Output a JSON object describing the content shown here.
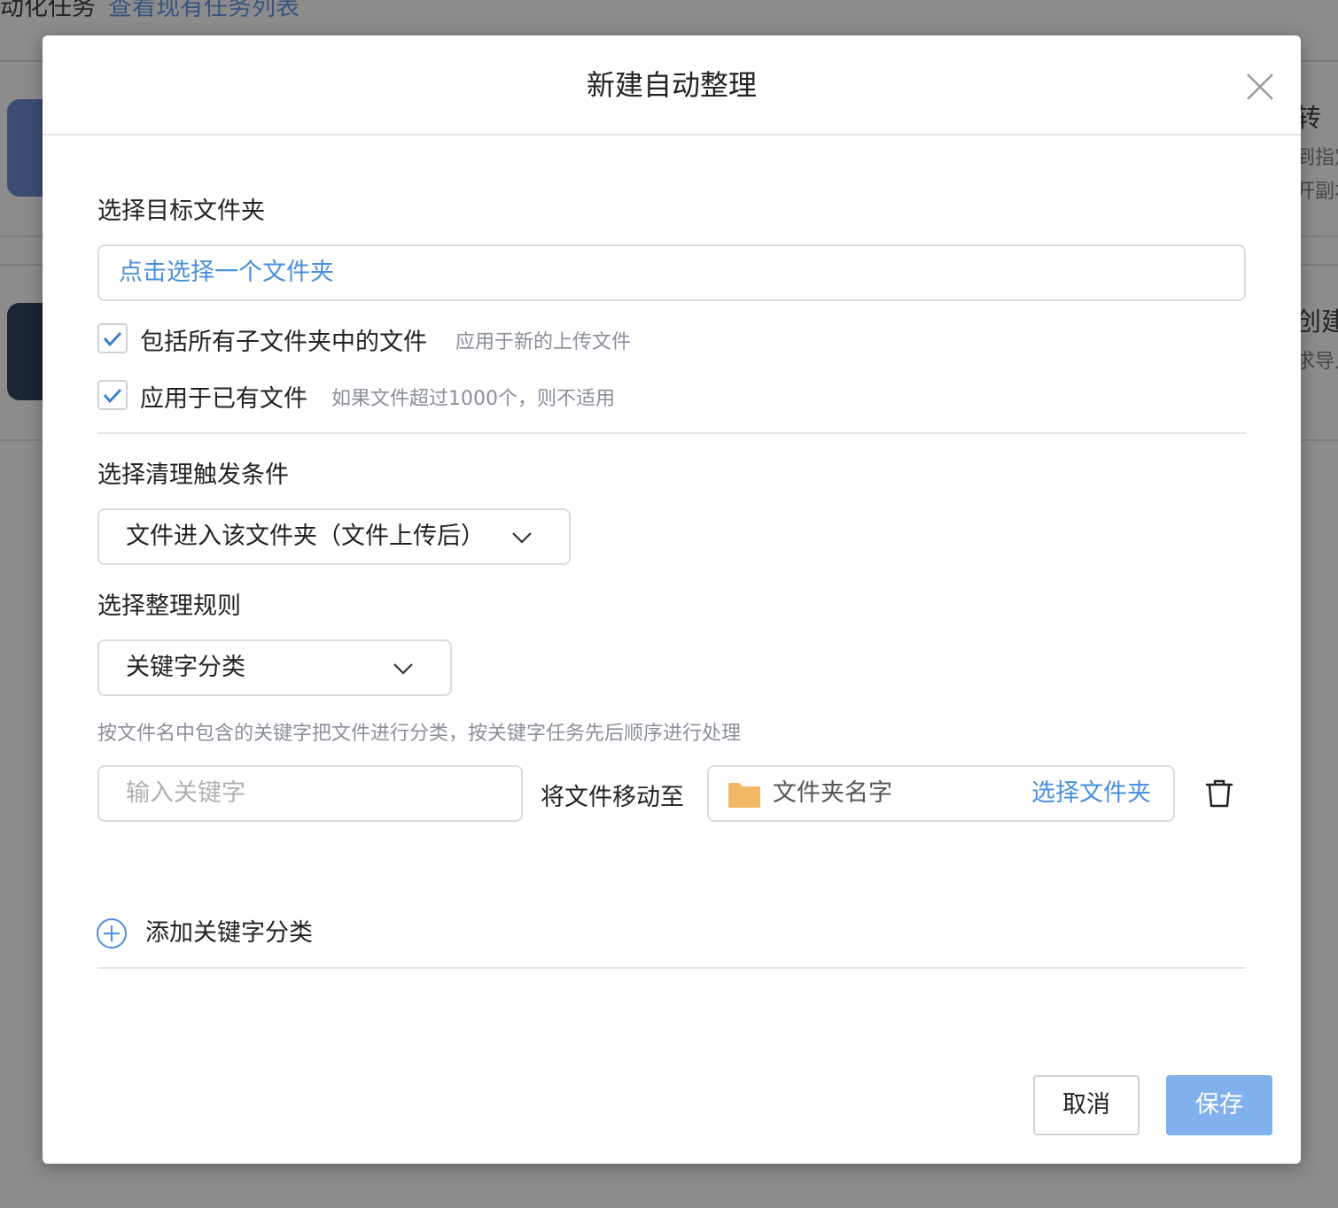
{
  "background": {
    "top_text": "动化任务",
    "top_link": "查看现有任务列表",
    "right_items": [
      {
        "title": "转",
        "sub1": "到指定",
        "sub2": "开副本"
      },
      {
        "title": "创建",
        "sub1": "求导入"
      }
    ]
  },
  "modal": {
    "title": "新建自动整理",
    "close_icon": "close-icon",
    "target_section": {
      "label": "选择目标文件夹",
      "picker_text": "点击选择一个文件夹"
    },
    "options": [
      {
        "label": "包括所有子文件夹中的文件",
        "hint": "应用于新的上传文件",
        "checked": true
      },
      {
        "label": "应用于已有文件",
        "hint": "如果文件超过1000个，则不适用",
        "checked": true
      }
    ],
    "trigger_section": {
      "label": "选择清理触发条件",
      "selected": "文件进入该文件夹（文件上传后）"
    },
    "rule_section": {
      "label": "选择整理规则",
      "selected": "关键字分类",
      "description": "按文件名中包含的关键字把文件进行分类，按关键字任务先后顺序进行处理"
    },
    "keyword_row": {
      "keyword_placeholder": "输入关键字",
      "move_label": "将文件移动至",
      "folder_name": "文件夹名字",
      "choose_folder_link": "选择文件夹",
      "folder_icon": "folder-icon",
      "delete_icon": "trash-icon"
    },
    "add_keyword_label": "添加关键字分类",
    "footer": {
      "cancel_label": "取消",
      "save_label": "保存"
    }
  },
  "colors": {
    "accent": "#4a8fdb",
    "save_button": "#7fb1ec",
    "folder": "#f0b865",
    "checkbox_check": "#3f7fd3"
  }
}
